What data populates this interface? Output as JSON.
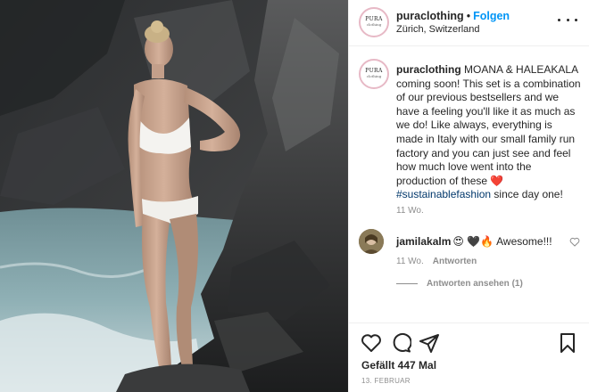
{
  "post": {
    "username": "puraclothing",
    "dot": "•",
    "follow_label": "Folgen",
    "location": "Zürich, Switzerland",
    "avatar_logo_top": "PURA",
    "avatar_logo_bottom": "clothing"
  },
  "caption": {
    "username": "puraclothing",
    "text": "MOANA & HALEAKALA coming soon! This set is a combination of our previous bestsellers and we have a feeling you'll like it as much as we do! Like always, everything is made in Italy with our small family run factory and you can just see and feel how much love went into the production of these",
    "heart": "❤️",
    "hashtag": "#sustainablefashion",
    "text_end": "since day one!",
    "time": "11 Wo."
  },
  "comment": {
    "username": "jamilakalm",
    "emoji": "😍 🖤🔥",
    "text": "Awesome!!!",
    "time": "11 Wo.",
    "reply_label": "Antworten",
    "view_replies_label": "Antworten ansehen (1)"
  },
  "actions": {
    "likes": "Gefällt 447 Mal",
    "date": "13. FEBRUAR"
  },
  "icons": {
    "more": "more-options-icon",
    "like": "heart-icon",
    "comment": "comment-icon",
    "share": "share-icon",
    "save": "bookmark-icon",
    "comment_like": "small-heart-icon"
  },
  "colors": {
    "link_blue": "#0095f6",
    "hashtag": "#00376b",
    "meta_gray": "#8e8e8e",
    "heart_red": "#ed4956"
  }
}
